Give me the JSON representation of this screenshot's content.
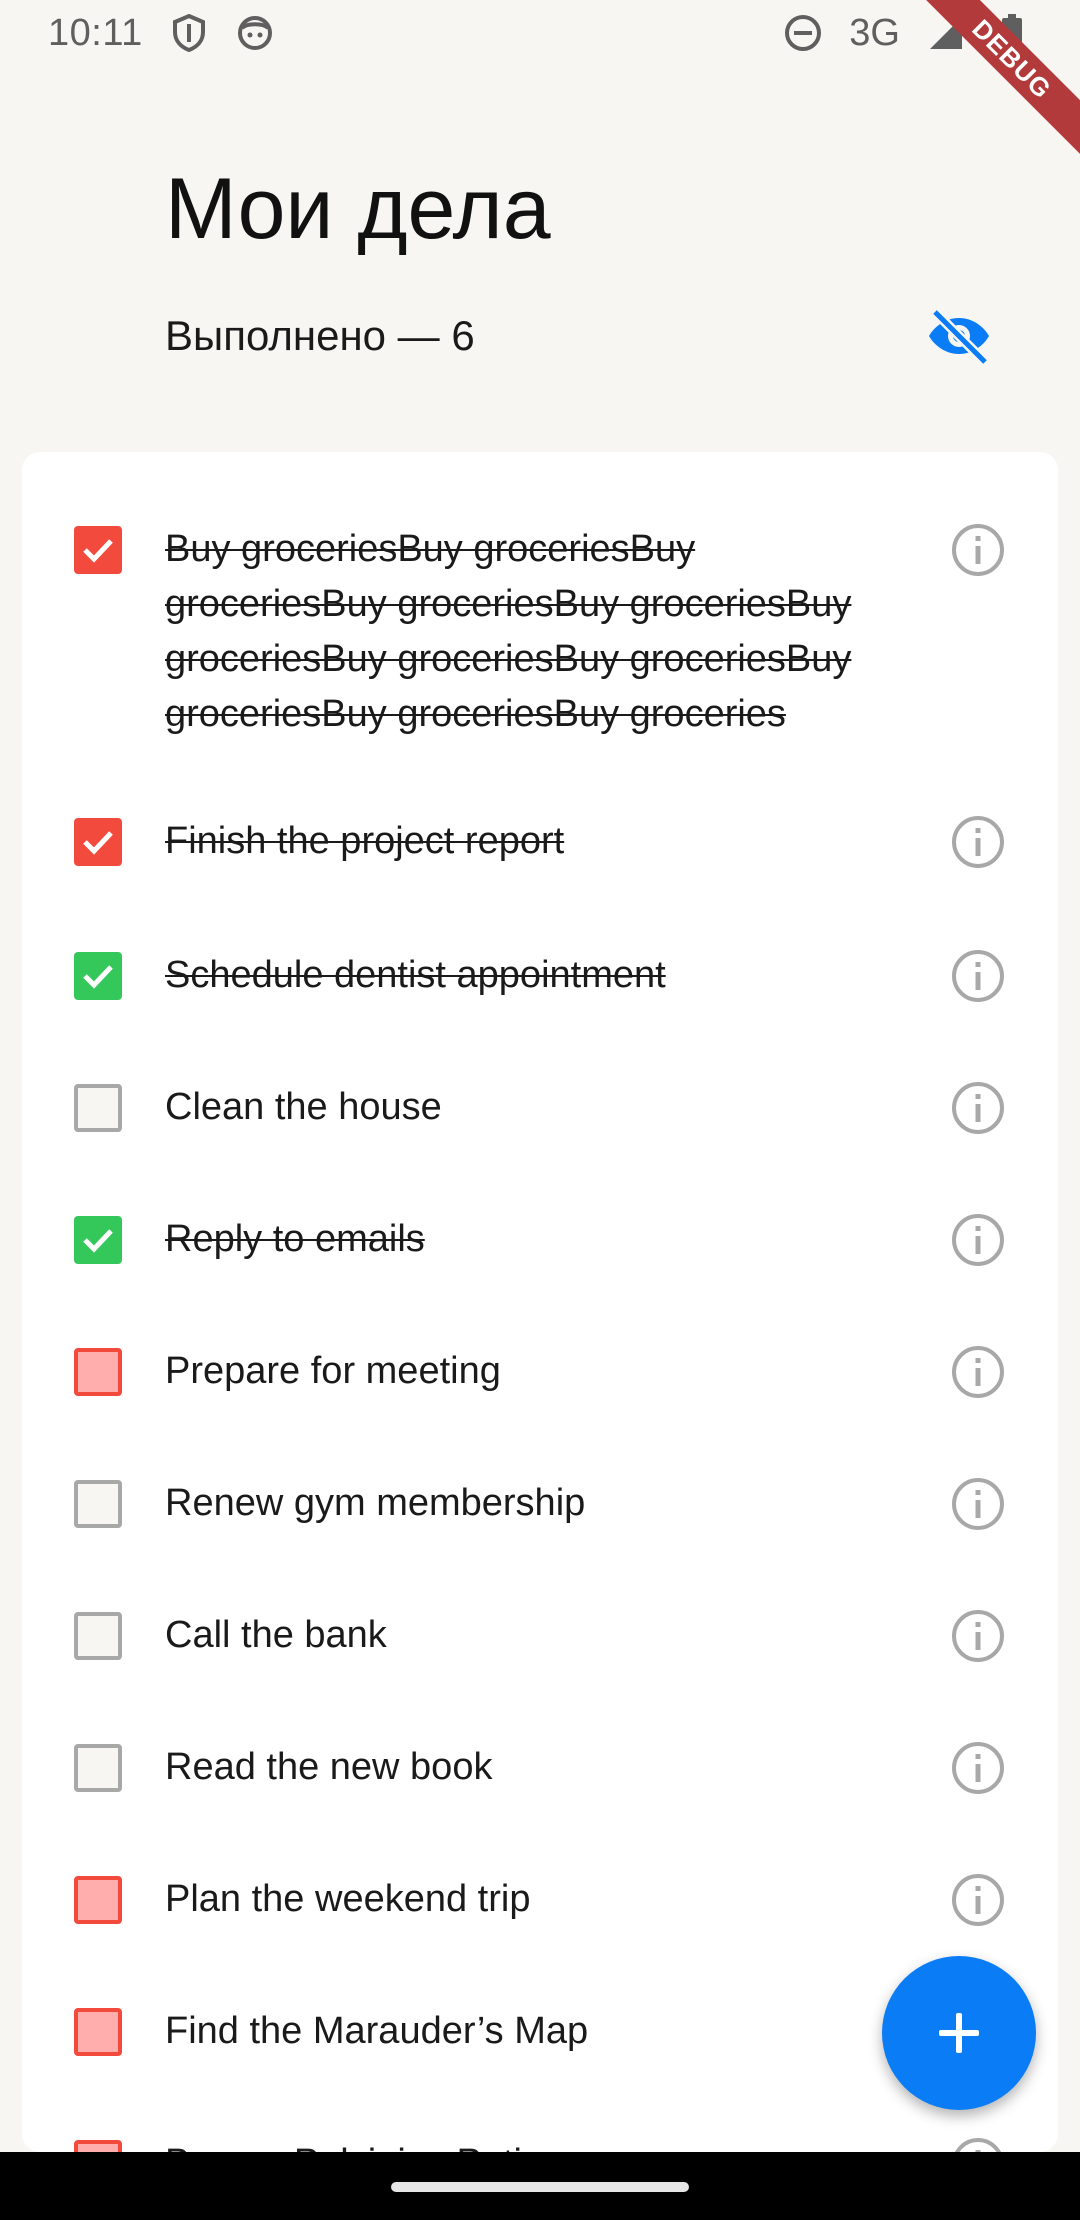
{
  "status_bar": {
    "time": "10:11",
    "network": "3G",
    "icons": [
      "shield-icon",
      "android-face-icon",
      "do-not-disturb-icon",
      "signal-icon",
      "battery-icon"
    ]
  },
  "debug_banner": "DEBUG",
  "header": {
    "title": "Мои дела",
    "completed_label": "Выполнено — 6",
    "visibility_icon": "visibility-off-icon",
    "accent_color": "#0a7cf6"
  },
  "tasks": [
    {
      "text": "Buy groceriesBuy groceriesBuy groceriesBuy groceriesBuy groceriesBuy groceriesBuy groceriesBuy groceriesBuy groceriesBuy groceriesBuy groceries",
      "done": true,
      "checkbox": "checked-red"
    },
    {
      "text": "Finish the project report",
      "done": true,
      "checkbox": "checked-red"
    },
    {
      "text": "Schedule dentist appointment",
      "done": true,
      "checkbox": "checked-green"
    },
    {
      "text": "Clean the house",
      "done": false,
      "checkbox": "empty-gray"
    },
    {
      "text": "Reply to emails",
      "done": true,
      "checkbox": "checked-green"
    },
    {
      "text": "Prepare for meeting",
      "done": false,
      "checkbox": "empty-red"
    },
    {
      "text": "Renew gym membership",
      "done": false,
      "checkbox": "empty-gray"
    },
    {
      "text": "Call the bank",
      "done": false,
      "checkbox": "empty-gray"
    },
    {
      "text": "Read the new book",
      "done": false,
      "checkbox": "empty-gray"
    },
    {
      "text": "Plan the weekend trip",
      "done": false,
      "checkbox": "empty-red"
    },
    {
      "text": "Find the Marauder’s Map",
      "done": false,
      "checkbox": "empty-red"
    },
    {
      "text": "Brew a Polyjuice Potion",
      "done": false,
      "checkbox": "empty-red"
    }
  ],
  "fab": {
    "icon": "plus-icon"
  },
  "colors": {
    "red": "#f24a3c",
    "light_red": "#ffadad",
    "green": "#34c759",
    "gray": "#a8a8a8"
  }
}
